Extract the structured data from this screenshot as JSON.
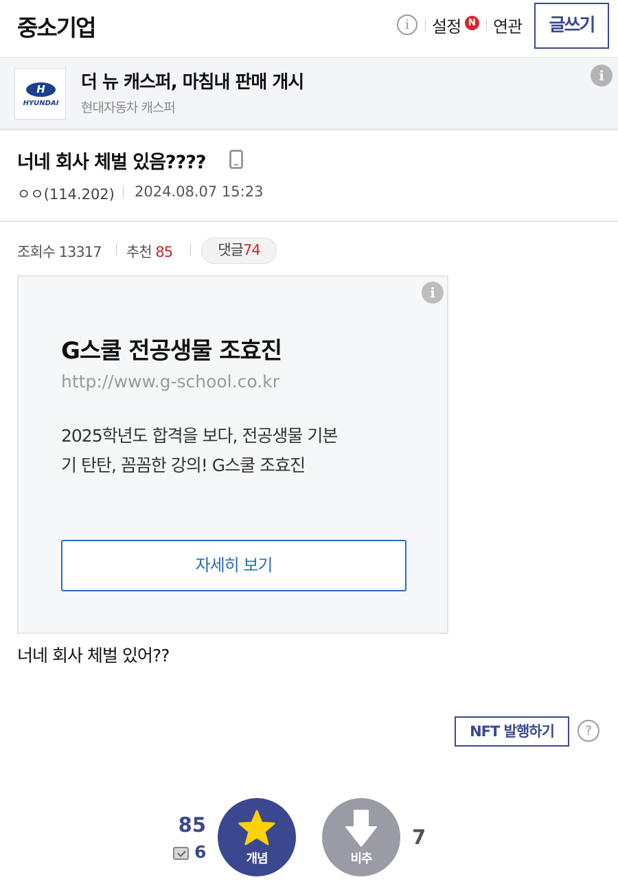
{
  "header": {
    "gallery_title": "중소기업",
    "info_symbol": "i",
    "settings_label": "설정",
    "settings_badge": "N",
    "related_label": "연관",
    "write_label": "글쓰기"
  },
  "news": {
    "logo_symbol": "H",
    "logo_text": "HYUNDAI",
    "title": "더 뉴 캐스퍼, 마침내 판매 개시",
    "subtitle": "현대자동차 캐스퍼",
    "info_symbol": "i"
  },
  "post": {
    "title": "너네 회사 체벌 있음????",
    "author": "ㅇㅇ(114.202)",
    "date": "2024.08.07 15:23",
    "views_label": "조회수",
    "views": "13317",
    "recommend_label": "추천",
    "recommend": "85",
    "comments_label": "댓글",
    "comments": "74",
    "body": "너네 회사 체벌 있어??"
  },
  "ad": {
    "info_symbol": "i",
    "title": "G스쿨 전공생물 조효진",
    "url": "http://www.g-school.co.kr",
    "desc_line1": "2025학년도 합격을 보다, 전공생물 기본",
    "desc_line2": "기 탄탄, 꼼꼼한 강의! G스쿨 조효진",
    "button_label": "자세히 보기"
  },
  "nft": {
    "button_label": "NFT 발행하기",
    "help_symbol": "?"
  },
  "vote": {
    "up_count": "85",
    "fix_count": "6",
    "up_label": "개념",
    "down_label": "비추",
    "down_count": "7"
  },
  "colors": {
    "brand": "#3b4890",
    "accent_red": "#c5282b",
    "ad_button": "#2a6bb5",
    "downvote": "#9b9ba6",
    "star": "#ffd200"
  }
}
